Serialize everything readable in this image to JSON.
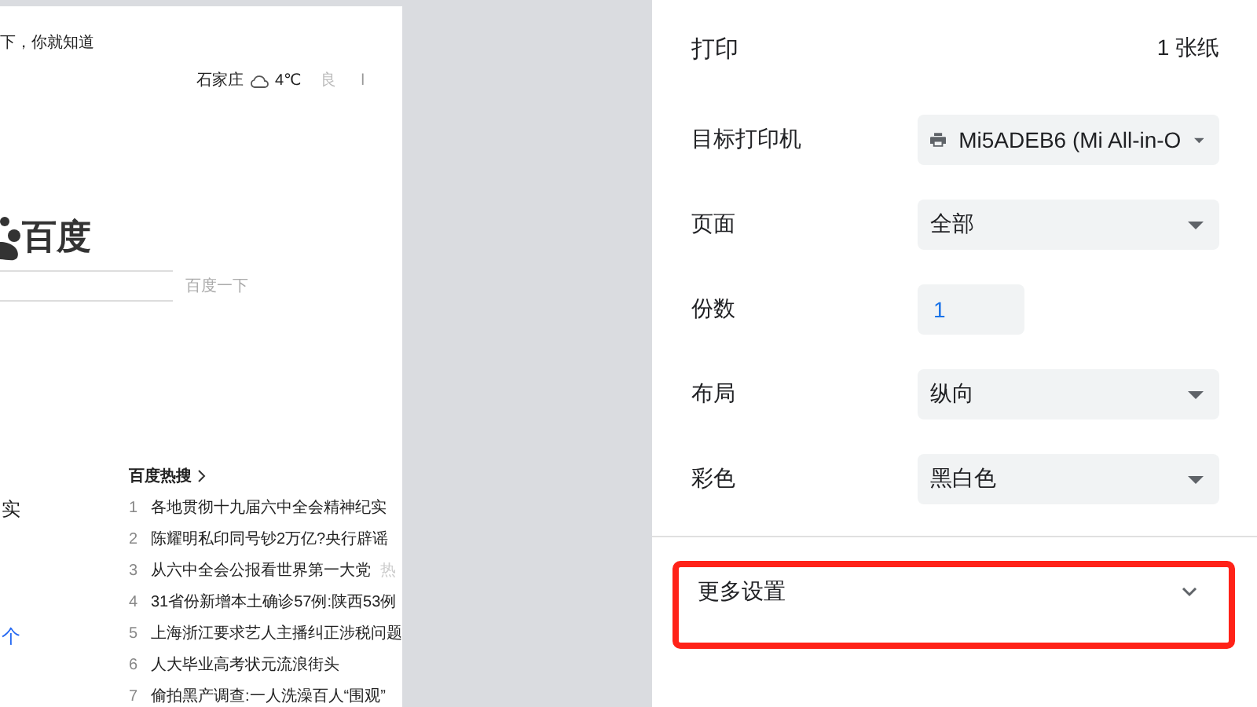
{
  "preview": {
    "tagline": "下，你就知道",
    "weather": {
      "city": "石家庄",
      "temp": "4℃",
      "air": "良",
      "extra": "l"
    },
    "logo_text": "百度",
    "search_button": "百度一下",
    "left_fragments": [
      {
        "text": "实",
        "link": false
      },
      {
        "text": "个",
        "link": true
      }
    ],
    "hot_list": {
      "title": "百度热搜",
      "items": [
        {
          "rank": "1",
          "title": "各地贯彻十九届六中全会精神纪实"
        },
        {
          "rank": "2",
          "title": "陈耀明私印同号钞2万亿?央行辟谣"
        },
        {
          "rank": "3",
          "title": "从六中全会公报看世界第一大党",
          "badge": "热"
        },
        {
          "rank": "4",
          "title": "31省份新增本土确诊57例:陕西53例"
        },
        {
          "rank": "5",
          "title": "上海浙江要求艺人主播纠正涉税问题"
        },
        {
          "rank": "6",
          "title": "人大毕业高考状元流浪街头"
        },
        {
          "rank": "7",
          "title": "偷拍黑产调查:一人洗澡百人“围观”"
        }
      ]
    }
  },
  "panel": {
    "title": "打印",
    "sheets": "1 张纸",
    "settings": [
      {
        "label": "目标打印机",
        "kind": "printer-select",
        "value": "Mi5ADEB6 (Mi All-in-O"
      },
      {
        "label": "页面",
        "kind": "select",
        "value": "全部"
      },
      {
        "label": "份数",
        "kind": "number",
        "value": "1"
      },
      {
        "label": "布局",
        "kind": "select",
        "value": "纵向"
      },
      {
        "label": "彩色",
        "kind": "select",
        "value": "黑白色"
      }
    ],
    "more_settings": {
      "label": "更多设置",
      "expanded": false,
      "highlighted": true
    }
  }
}
